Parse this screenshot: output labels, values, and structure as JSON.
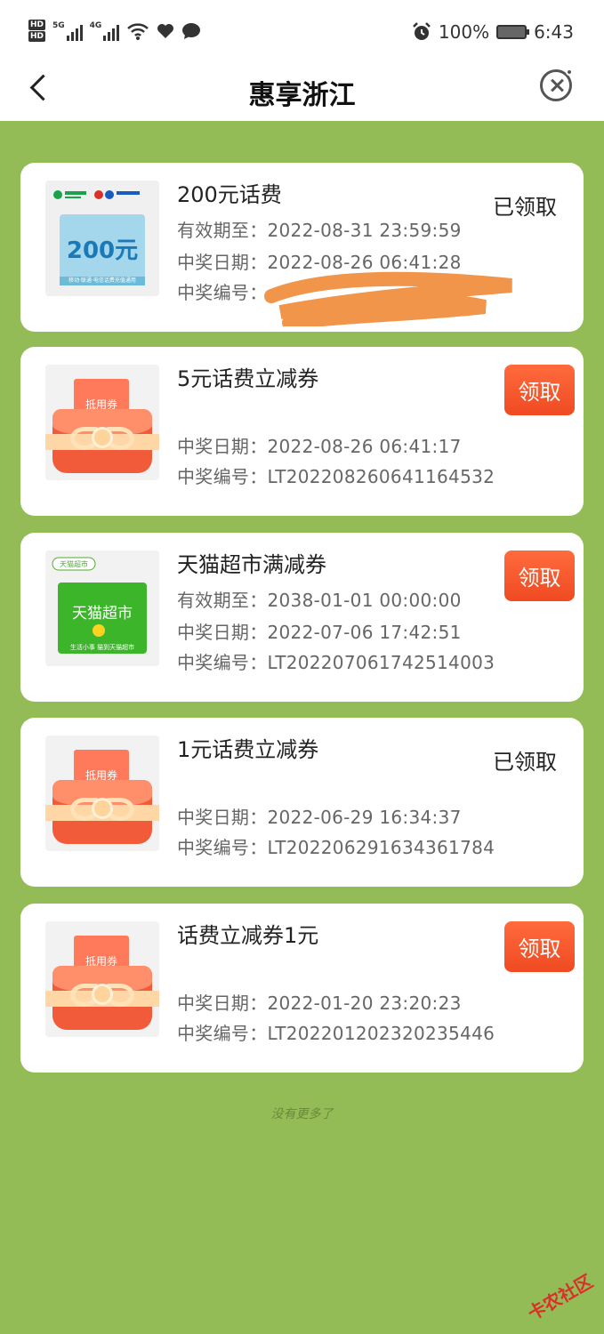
{
  "status_bar": {
    "hd1": "HD",
    "hd2": "HD",
    "net1": "5G",
    "net2": "4G",
    "battery": "100%",
    "time": "6:43"
  },
  "nav": {
    "title": "惠享浙江",
    "back_icon": "chevron-left-icon",
    "close_icon": "close-circle-icon"
  },
  "thumb_labels": {
    "envelope_label": "抵用券",
    "phone_card_amount": "200元",
    "phone_card_desc": "移动·联通·电信话费充值通用",
    "tmall_badge": "天猫超市",
    "tmall_logo": "天猫超市",
    "tmall_slogan": "生活小事 猫到天猫超市"
  },
  "cards": [
    {
      "title": "200元话费",
      "valid": "有效期至：2022-08-31 23:59:59",
      "date": "中奖日期：2022-08-26 06:41:28",
      "code": "中奖编号：",
      "status": "已领取",
      "thumb": "phone-card"
    },
    {
      "title": "5元话费立减券",
      "date": "中奖日期：2022-08-26 06:41:17",
      "code": "中奖编号：LT20220826064116453​2",
      "action": "领取",
      "thumb": "envelope"
    },
    {
      "title": "天猫超市满减券",
      "valid": "有效期至：2038-01-01 00:00:00",
      "date": "中奖日期：2022-07-06 17:42:51",
      "code": "中奖编号：LT20220706174251400​3",
      "action": "领取",
      "thumb": "tmall"
    },
    {
      "title": "1元话费立减券",
      "date": "中奖日期：2022-06-29 16:34:37",
      "code": "中奖编号：LT20220629163436178​4",
      "status": "已领取",
      "thumb": "envelope"
    },
    {
      "title": "话费立减券1元",
      "date": "中奖日期：2022-01-20 23:20:23",
      "code": "中奖编号：LT20220120232023544​6",
      "action": "领取",
      "thumb": "envelope"
    }
  ],
  "footer": {
    "no_more": "没有更多了",
    "watermark": "卡农社区"
  },
  "colors": {
    "background": "#93bc56",
    "claim_button": "#f04a22"
  }
}
